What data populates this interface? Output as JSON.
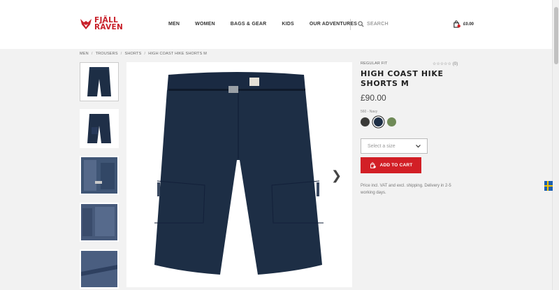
{
  "brand": {
    "name_line1": "FJÄLL",
    "name_line2": "RÄVEN",
    "color": "#c8202a"
  },
  "nav": {
    "items": [
      "MEN",
      "WOMEN",
      "BAGS & GEAR",
      "KIDS",
      "OUR ADVENTURES"
    ]
  },
  "search": {
    "label": "SEARCH",
    "icon": "search-icon"
  },
  "cart": {
    "price": "£0.00",
    "icon": "cart-icon"
  },
  "breadcrumb": [
    "MEN",
    "TROUSERS",
    "SHORTS",
    "HIGH COAST HIKE SHORTS M"
  ],
  "product": {
    "fit": "REGULAR FIT",
    "rating_count": "(0)",
    "rating": 0,
    "title": "HIGH COAST HIKE SHORTS M",
    "price": "£90.00",
    "color_label": "560 - Navy",
    "swatches": [
      {
        "name": "dark-grey",
        "color": "#3a3a38"
      },
      {
        "name": "navy",
        "color": "#1d2e45",
        "selected": true
      },
      {
        "name": "green",
        "color": "#6f8a57"
      }
    ],
    "size_placeholder": "Select a size",
    "add_to_cart": "ADD TO CART",
    "note": "Price incl. VAT and excl. shipping. Delivery in 2-5 working days."
  },
  "colors": {
    "accent": "#d21f26",
    "navy": "#1d2e45"
  }
}
